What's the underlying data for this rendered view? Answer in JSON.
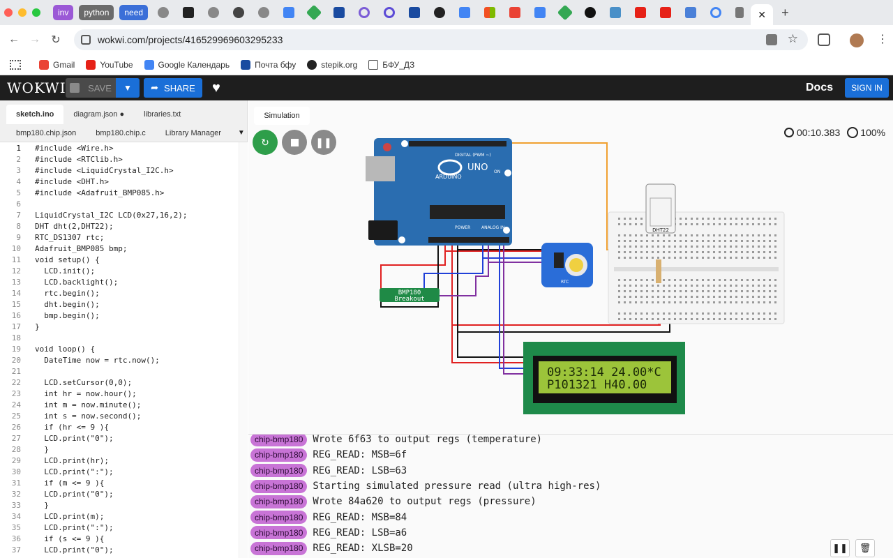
{
  "browser": {
    "tabs": [
      {
        "label": "inv",
        "color": "#9b59d6"
      },
      {
        "label": "python",
        "color": "#6b6b6b"
      },
      {
        "label": "need",
        "color": "#3b6fd8"
      }
    ],
    "url": "wokwi.com/projects/416529969603295233",
    "bookmarks": [
      "Gmail",
      "YouTube",
      "Google Календарь",
      "Почта бфу",
      "stepik.org",
      "БФУ_ДЗ"
    ]
  },
  "header": {
    "logo": "WOKWI",
    "save_label": "SAVE",
    "share_label": "SHARE",
    "docs_label": "Docs",
    "signin_label": "SIGN IN"
  },
  "editor": {
    "tabs_row1": [
      "sketch.ino",
      "diagram.json ●",
      "libraries.txt"
    ],
    "tabs_row2": [
      "bmp180.chip.json",
      "bmp180.chip.c",
      "Library Manager"
    ],
    "lines": [
      "#include <Wire.h>",
      "#include <RTClib.h>",
      "#include <LiquidCrystal_I2C.h>",
      "#include <DHT.h>",
      "#include <Adafruit_BMP085.h>",
      "",
      "LiquidCrystal_I2C LCD(0x27,16,2);",
      "DHT dht(2,DHT22);",
      "RTC_DS1307 rtc;",
      "Adafruit_BMP085 bmp;",
      "void setup() {",
      "  LCD.init();",
      "  LCD.backlight();",
      "  rtc.begin();",
      "  dht.begin();",
      "  bmp.begin();",
      "}",
      "",
      "void loop() {",
      "  DateTime now = rtc.now();",
      "",
      "  LCD.setCursor(0,0);",
      "  int hr = now.hour();",
      "  int m = now.minute();",
      "  int s = now.second();",
      "  if (hr <= 9 ){",
      "  LCD.print(\"0\");",
      "  }",
      "  LCD.print(hr);",
      "  LCD.print(\":\");",
      "  if (m <= 9 ){",
      "  LCD.print(\"0\");",
      "  }",
      "  LCD.print(m);",
      "  LCD.print(\":\");",
      "  if (s <= 9 ){",
      "  LCD.print(\"0\");"
    ]
  },
  "simulation": {
    "tab_label": "Simulation",
    "time": "00:10.383",
    "speed": "100%",
    "arduino": {
      "brand": "ARDUINO",
      "model": "UNO",
      "on_label": "ON",
      "digital_label": "DIGITAL (PWM ~)",
      "power_label": "POWER",
      "analog_label": "ANALOG IN"
    },
    "bmp_label_1": "BMP180",
    "bmp_label_2": "Breakout",
    "dht_label": "DHT22",
    "rtc_label": "RTC",
    "lcd_line1": "09:33:14 24.00*C",
    "lcd_line2": "P101321 H40.00"
  },
  "console": {
    "source": "chip-bmp180",
    "messages": [
      "Wrote 6f63 to output regs (temperature)",
      "REG_READ: MSB=6f",
      "REG_READ: LSB=63",
      "Starting simulated pressure read (ultra high-res)",
      "Wrote 84a620 to output regs (pressure)",
      "REG_READ: MSB=84",
      "REG_READ: LSB=a6",
      "REG_READ: XLSB=20"
    ]
  },
  "colors": {
    "accent": "#1a6fd8",
    "badge": "#c874d6",
    "pcb_blue": "#2a6db0",
    "lcd_green": "#9cc43a"
  }
}
